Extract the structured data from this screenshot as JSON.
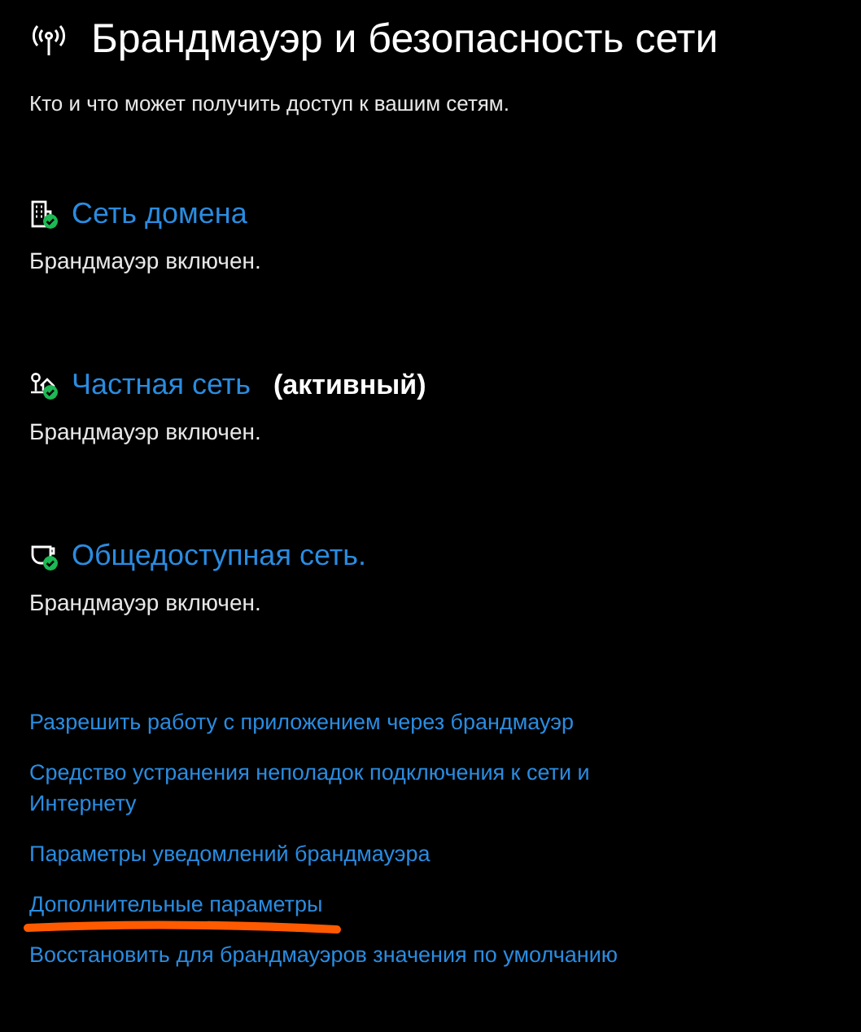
{
  "page": {
    "title": "Брандмауэр и безопасность сети",
    "subtitle": "Кто и что может получить доступ к вашим сетям."
  },
  "networks": [
    {
      "kind": "domain",
      "name": "Сеть домена",
      "status": "Брандмауэр включен."
    },
    {
      "kind": "private",
      "name": "Частная сеть",
      "badge": "(активный)",
      "status": "Брандмауэр включен."
    },
    {
      "kind": "public",
      "name": "Общедоступная сеть.",
      "status": "Брандмауэр включен."
    }
  ],
  "links": [
    {
      "label": "Разрешить работу с приложением через брандмауэр",
      "highlighted": false
    },
    {
      "label": "Средство устранения неполадок подключения к сети и Интернету",
      "highlighted": false
    },
    {
      "label": "Параметры уведомлений брандмауэра",
      "highlighted": false
    },
    {
      "label": "Дополнительные параметры",
      "highlighted": true
    },
    {
      "label": "Восстановить для брандмауэров значения по умолчанию",
      "highlighted": false
    }
  ]
}
